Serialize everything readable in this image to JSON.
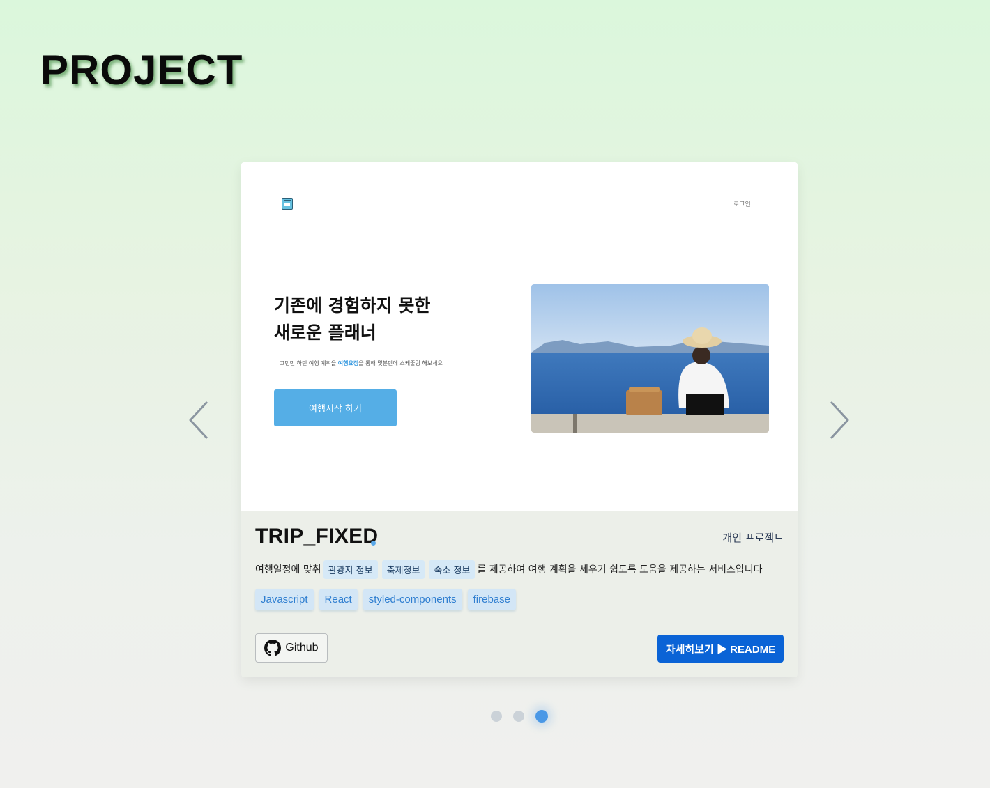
{
  "section": {
    "title": "PROJECT"
  },
  "project": {
    "name": "TRIP_FIXED",
    "type_label": "개인 프로젝트",
    "preview": {
      "login_label": "로그인",
      "heading_line1": "기존에 경험하지 못한",
      "heading_line2": "새로운 플래너",
      "subtitle_before": "고민만 하던 여행 계획을",
      "subtitle_highlight": "여행요정",
      "subtitle_after": "을 통해 몇분만에 스케줄링 해보세요",
      "cta_label": "여행시작 하기"
    },
    "description": {
      "prefix": "여행일정에 맞춰",
      "chips": [
        "관광지 정보",
        "축제정보",
        "숙소 정보"
      ],
      "suffix": "를 제공하여 여행 계획을 세우기 쉽도록 도움을 제공하는 서비스입니다"
    },
    "tech_stack": [
      "Javascript",
      "React",
      "styled-components",
      "firebase"
    ],
    "github_label": "Github",
    "readme_label": "자세히보기 ▶ README"
  },
  "carousel": {
    "slide_count": 3,
    "active_index": 2
  },
  "colors": {
    "accent": "#0a63d6",
    "chip_text": "#2f7ed0",
    "active_dot": "#4a98e6"
  },
  "icons": {
    "prev": "chevron-left-icon",
    "next": "chevron-right-icon",
    "github": "github-icon"
  }
}
